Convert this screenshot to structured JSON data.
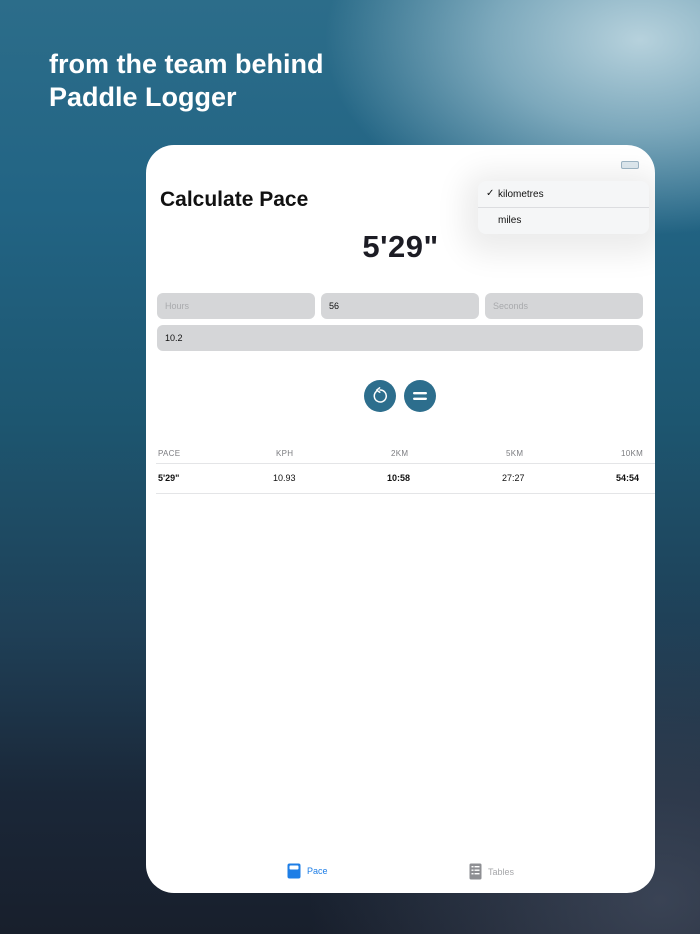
{
  "promo": {
    "headline_line1": "from the team behind",
    "headline_line2": "Paddle Logger"
  },
  "app": {
    "title": "Calculate Pace",
    "pace_result": "5'29\"",
    "unit_menu": {
      "items": [
        {
          "label": "kilometres",
          "selected": true
        },
        {
          "label": "miles",
          "selected": false
        }
      ]
    },
    "inputs": {
      "hours": {
        "value": "",
        "placeholder": "Hours"
      },
      "minutes": {
        "value": "56",
        "placeholder": ""
      },
      "seconds": {
        "value": "",
        "placeholder": "Seconds"
      },
      "distance": {
        "value": "10.2",
        "placeholder": ""
      }
    },
    "buttons": {
      "reset_icon": "reset-icon",
      "equals_icon": "equals-icon"
    },
    "table": {
      "headers": [
        "PACE",
        "KPH",
        "2KM",
        "5KM",
        "10KM"
      ],
      "rows": [
        [
          "5'29\"",
          "10.93",
          "10:58",
          "27:27",
          "54:54"
        ]
      ]
    },
    "tabs": [
      {
        "label": "Pace",
        "icon": "pace-tab-icon",
        "active": true
      },
      {
        "label": "Tables",
        "icon": "tables-tab-icon",
        "active": false
      }
    ],
    "colors": {
      "accent": "#2d6e8d",
      "tab_active": "#1e7ee6",
      "field_bg": "#d5d6d8"
    }
  }
}
